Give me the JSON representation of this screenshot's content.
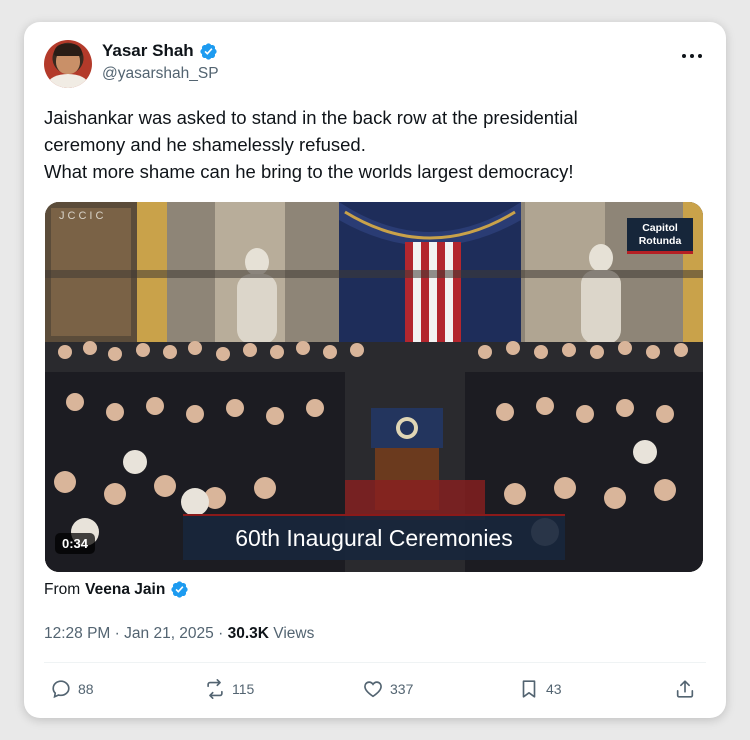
{
  "tweet": {
    "author": {
      "display_name": "Yasar Shah",
      "handle": "@yasarshah_SP",
      "verified": true
    },
    "text_lines": [
      "Jaishankar was asked to stand in the back row at the presidential",
      "ceremony and he shamelessly refused.",
      "What more shame can he bring to the worlds largest democracy!"
    ],
    "media": {
      "duration": "0:34",
      "location_tag_lines": [
        "Capitol",
        "Rotunda"
      ],
      "lower_third": "60th Inaugural Ceremonies",
      "logo_text": "JCCIC"
    },
    "source": {
      "prefix": "From",
      "name": "Veena Jain",
      "verified": true
    },
    "meta": {
      "time": "12:28 PM",
      "separator": "·",
      "date": "Jan 21, 2025",
      "views_count": "30.3K",
      "views_label": "Views"
    },
    "actions": {
      "replies": "88",
      "reposts": "115",
      "likes": "337",
      "bookmarks": "43"
    }
  },
  "colors": {
    "verified_blue": "#1d9bf0",
    "text_primary": "#0f1419",
    "text_secondary": "#536471",
    "lower_third_bg": "#18263c"
  }
}
